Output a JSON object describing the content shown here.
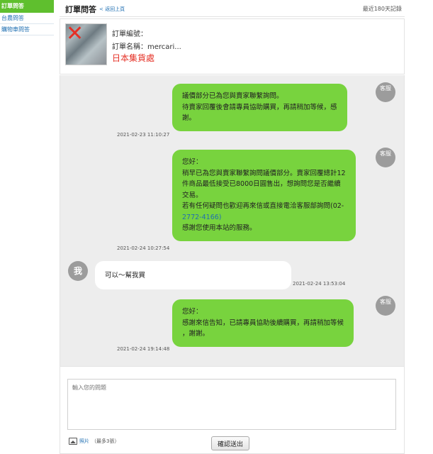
{
  "sidebar": {
    "items": [
      {
        "label": "訂單問答"
      },
      {
        "label": "台農問答"
      },
      {
        "label": "購物車問答"
      }
    ]
  },
  "header": {
    "title": "訂單問答",
    "back_link": "< 返回上頁",
    "days_note": "最近180天記錄"
  },
  "order": {
    "number_label": "訂單編號：",
    "name_label": "訂單名稱：mercari...",
    "source": "日本集貨處"
  },
  "messages": [
    {
      "sender": "staff",
      "avatar": "客服",
      "lines": [
        "議價部分已為您與賣家聯繫詢問。",
        "待賣家回覆後會請專員協助購買，再請稍加等候，感",
        "謝。"
      ],
      "timestamp": "2021-02-23 11:10:27"
    },
    {
      "sender": "staff",
      "avatar": "客服",
      "lines": [
        "您好：",
        "稍早已為您與賣家聯繫詢問議價部分。賣家回覆總計12",
        "件商品最低接受已8000日圓售出，想詢問您是否繼續",
        "交易。",
        "若有任何疑問也歡迎再來信或直接電洽客服部詢問(02-",
        "2772-4166)",
        "感謝您使用本站的服務。"
      ],
      "timestamp": "2021-02-24 10:27:54"
    },
    {
      "sender": "user",
      "avatar": "我",
      "lines": [
        "可以～幫我買"
      ],
      "timestamp": "2021-02-24 13:53:04"
    },
    {
      "sender": "staff",
      "avatar": "客服",
      "lines": [
        "您好：",
        "感謝來信告知，已請專員協助後續購買，再請稍加等候",
        "，謝謝。"
      ],
      "timestamp": "2021-02-24 19:14:48"
    }
  ],
  "composer": {
    "placeholder": "輸入您的問題",
    "photo_label": "照片",
    "photo_note": "（最多3張）",
    "submit_label": "確認送出"
  },
  "colors": {
    "staff_bubble": "#78d33e",
    "user_bubble": "#ffffff",
    "active_sidebar": "#5fbf2e",
    "link": "#1f6fb2",
    "accent_red": "#e53025"
  }
}
